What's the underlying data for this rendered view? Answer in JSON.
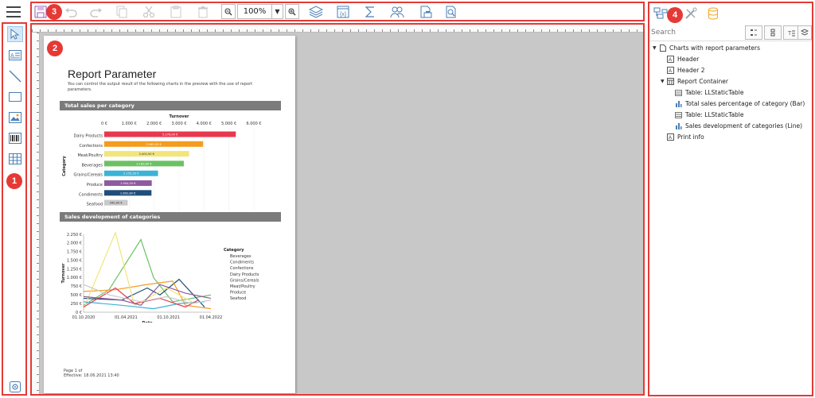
{
  "callouts": {
    "left_toolbar": "1",
    "workspace": "2",
    "top_toolbar": "3",
    "right_panel": "4"
  },
  "toolbar": {
    "zoom_value": "100%"
  },
  "report": {
    "title": "Report Parameter",
    "description": "You can control the output result of the following charts in the preview with the use of report parameters.",
    "section1": "Total sales per category",
    "section2": "Sales development of categories",
    "footer_page": "Page 1 of",
    "footer_effective": "Effective: 18.06.2021 13:40"
  },
  "chart_data": [
    {
      "type": "bar",
      "title": "Turnover",
      "ylabel": "Category",
      "x_ticks": [
        "0 €",
        "1.000 €",
        "2.000 €",
        "3.000 €",
        "4.000 €",
        "5.000 €",
        "6.000 €"
      ],
      "xlim": [
        0,
        6000
      ],
      "categories": [
        "Dairy Products",
        "Confections",
        "Meat/Poultry",
        "Beverages",
        "Grains/Cereals",
        "Produce",
        "Condiments",
        "Seafood"
      ],
      "values": [
        5276.0,
        3965.05,
        3400.9,
        3189.8,
        2155.5,
        1904.05,
        1892.8,
        940.0
      ],
      "data_labels": [
        "5.276,00 €",
        "3.965,05 €",
        "3.400,90 €",
        "3.189,80 €",
        "2.155,50 €",
        "1.904,05 €",
        "1.892,80 €",
        "940,00 €"
      ],
      "colors": [
        "#e8384f",
        "#f39c1f",
        "#f2e57a",
        "#6cc163",
        "#3bb3d6",
        "#8e5aa0",
        "#1f4e79",
        "#c9c9c9"
      ]
    },
    {
      "type": "line",
      "xlabel": "Date",
      "ylabel": "Turnover",
      "legend_title": "Category",
      "legend_placement": "right",
      "x_ticks": [
        "01.10.2020",
        "01.04.2021",
        "01.10.2021",
        "01.04.2022"
      ],
      "y_ticks": [
        "0 €",
        "250 €",
        "500 €",
        "750 €",
        "1.000 €",
        "1.250 €",
        "1.500 €",
        "1.750 €",
        "2.000 €",
        "2.250 €"
      ],
      "ylim": [
        0,
        2250
      ],
      "series": [
        {
          "name": "Beverages",
          "color": "#6cc163",
          "x": [
            0,
            0.2,
            0.45,
            0.55,
            0.7,
            1
          ],
          "values": [
            200,
            650,
            2100,
            1000,
            300,
            500
          ]
        },
        {
          "name": "Condiments",
          "color": "#1f4e79",
          "x": [
            0,
            0.3,
            0.5,
            0.6,
            0.75,
            0.95
          ],
          "values": [
            400,
            350,
            700,
            500,
            950,
            150
          ]
        },
        {
          "name": "Confections",
          "color": "#f39c1f",
          "x": [
            0,
            0.25,
            0.5,
            0.7,
            0.8,
            1
          ],
          "values": [
            600,
            650,
            800,
            900,
            200,
            100
          ]
        },
        {
          "name": "Dairy Products",
          "color": "#f2e57a",
          "x": [
            0,
            0.25,
            0.4,
            0.65,
            0.85
          ],
          "values": [
            100,
            2300,
            200,
            700,
            300
          ]
        },
        {
          "name": "Grains/Cereals",
          "color": "#3bb3d6",
          "x": [
            0,
            0.3,
            0.55,
            0.75,
            0.95
          ],
          "values": [
            300,
            200,
            100,
            250,
            300
          ]
        },
        {
          "name": "Meat/Poultry",
          "color": "#8e5aa0",
          "x": [
            0,
            0.3,
            0.45,
            0.6,
            0.8,
            1
          ],
          "values": [
            450,
            350,
            200,
            800,
            550,
            400
          ]
        },
        {
          "name": "Produce",
          "color": "#e8384f",
          "x": [
            0,
            0.25,
            0.4,
            0.6,
            0.8,
            0.9
          ],
          "values": [
            150,
            700,
            250,
            400,
            150,
            350
          ]
        },
        {
          "name": "Seafood",
          "color": "#c9c9c9",
          "x": [
            0,
            0.2,
            0.45,
            0.65,
            0.85,
            1
          ],
          "values": [
            800,
            500,
            300,
            450,
            250,
            350
          ]
        }
      ]
    }
  ],
  "right_panel": {
    "search_placeholder": "Search",
    "tree": [
      {
        "label": "Charts with report parameters",
        "level": 0,
        "icon": "document-icon",
        "expanded": true
      },
      {
        "label": "Header",
        "level": 1,
        "icon": "text-object-icon"
      },
      {
        "label": "Header 2",
        "level": 1,
        "icon": "text-object-icon"
      },
      {
        "label": "Report Container",
        "level": 1,
        "icon": "container-icon",
        "expanded": true
      },
      {
        "label": "Table: LLStaticTable",
        "level": 2,
        "icon": "table-icon"
      },
      {
        "label": "Total sales percentage of category (Bar)",
        "level": 2,
        "icon": "bar-chart-icon"
      },
      {
        "label": "Table: LLStaticTable",
        "level": 2,
        "icon": "table-icon"
      },
      {
        "label": "Sales development of categories (Line)",
        "level": 2,
        "icon": "bar-chart-icon"
      },
      {
        "label": "Print info",
        "level": 1,
        "icon": "text-object-icon"
      }
    ]
  }
}
